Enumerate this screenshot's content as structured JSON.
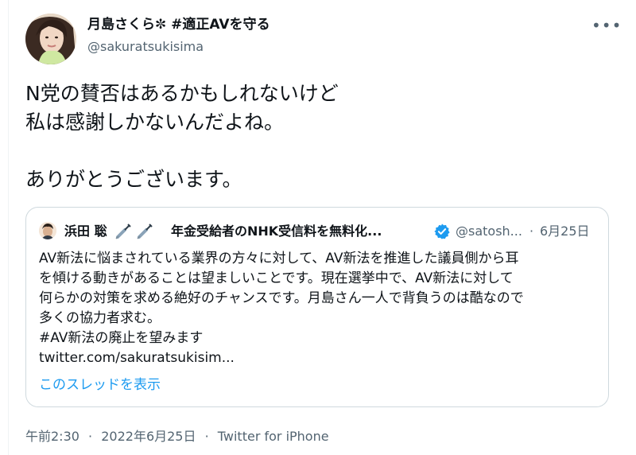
{
  "author": {
    "display_name": "月島さくら✼ #適正AVを守る",
    "handle": "@sakuratsukisima",
    "more_label": "•••"
  },
  "tweet": {
    "text": "N党の賛否はあるかもしれないけど\n私は感謝しかないんだよね。\n\nありがとうございます。"
  },
  "quoted_tweet": {
    "author_name": "浜田 聡",
    "author_emoji_icons": [
      "syringe-icon",
      "syringe-icon"
    ],
    "title": "年金受給者のNHK受信料を無料化...",
    "handle": "@satosh...",
    "separator": "·",
    "date": "6月25日",
    "text": "AV新法に悩まされている業界の方々に対して、AV新法を推進した議員側から耳\nを傾ける動きがあることは望ましいことです。現在選挙中で、AV新法に対して\n何らかの対策を求める絶好のチャンスです。月島さん一人で背負うのは酷なので\n多くの協力者求む。\n#AV新法の廃止を望みます\ntwitter.com/sakuratsukisim...",
    "thread_link": "このスレッドを表示"
  },
  "meta": {
    "time": "午前2:30",
    "separator": "·",
    "date": "2022年6月25日",
    "source": "Twitter for iPhone"
  },
  "colors": {
    "text": "#0f1419",
    "secondary": "#536471",
    "link": "#1d9bf0",
    "border": "#cfd9de"
  }
}
